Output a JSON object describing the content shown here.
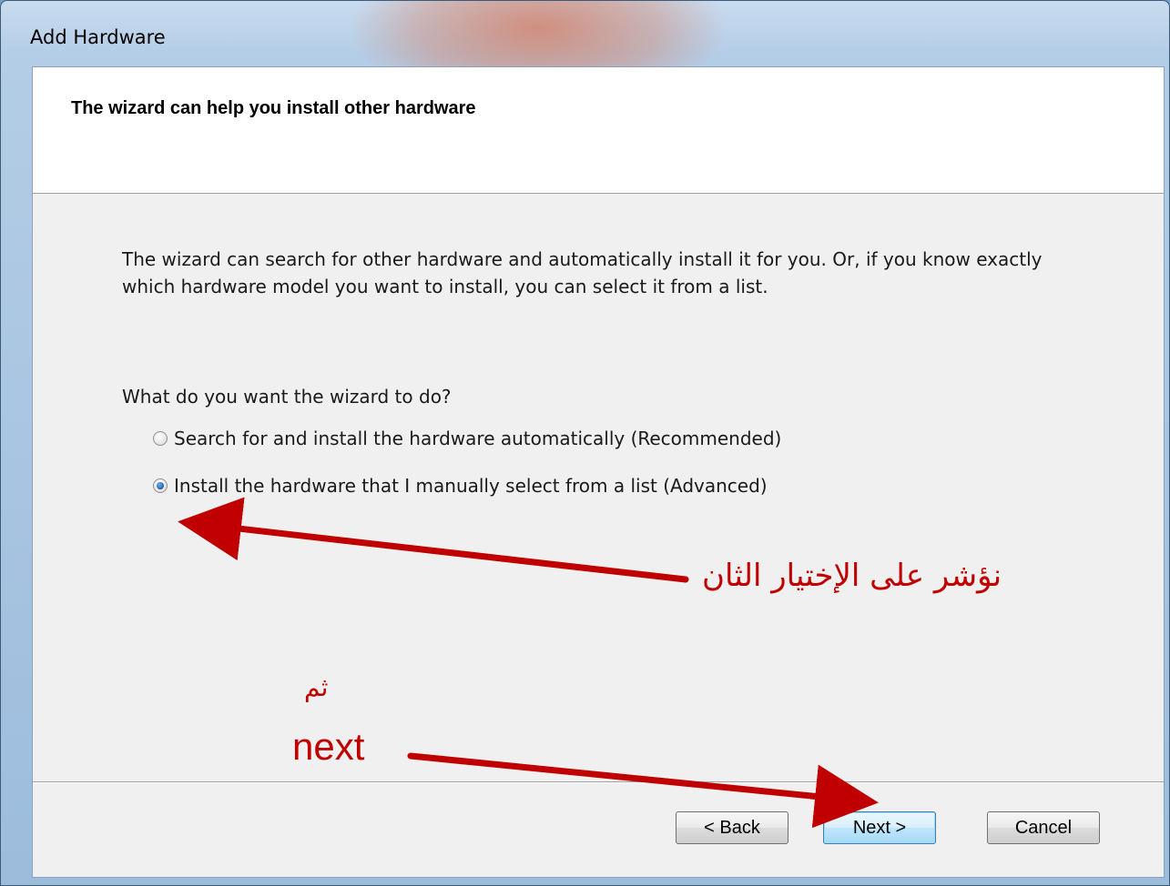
{
  "window": {
    "title": "Add Hardware"
  },
  "header": {
    "title": "The wizard can help you install other hardware"
  },
  "content": {
    "description": "The wizard can search for other hardware and automatically install it for you. Or, if you know exactly which hardware model you want to install, you can select it from a list.",
    "question": "What do you want the wizard to do?",
    "options": [
      {
        "label": "Search for and install the hardware automatically (Recommended)",
        "selected": false
      },
      {
        "label": "Install the hardware that I manually select from a list (Advanced)",
        "selected": true
      }
    ]
  },
  "buttons": {
    "back": "< Back",
    "next": "Next >",
    "cancel": "Cancel"
  },
  "annotations": {
    "arabic_line1": "نؤشر على الإختيار الثان",
    "arabic_line2": "ثم",
    "next_label": "next",
    "color": "#c00000"
  }
}
